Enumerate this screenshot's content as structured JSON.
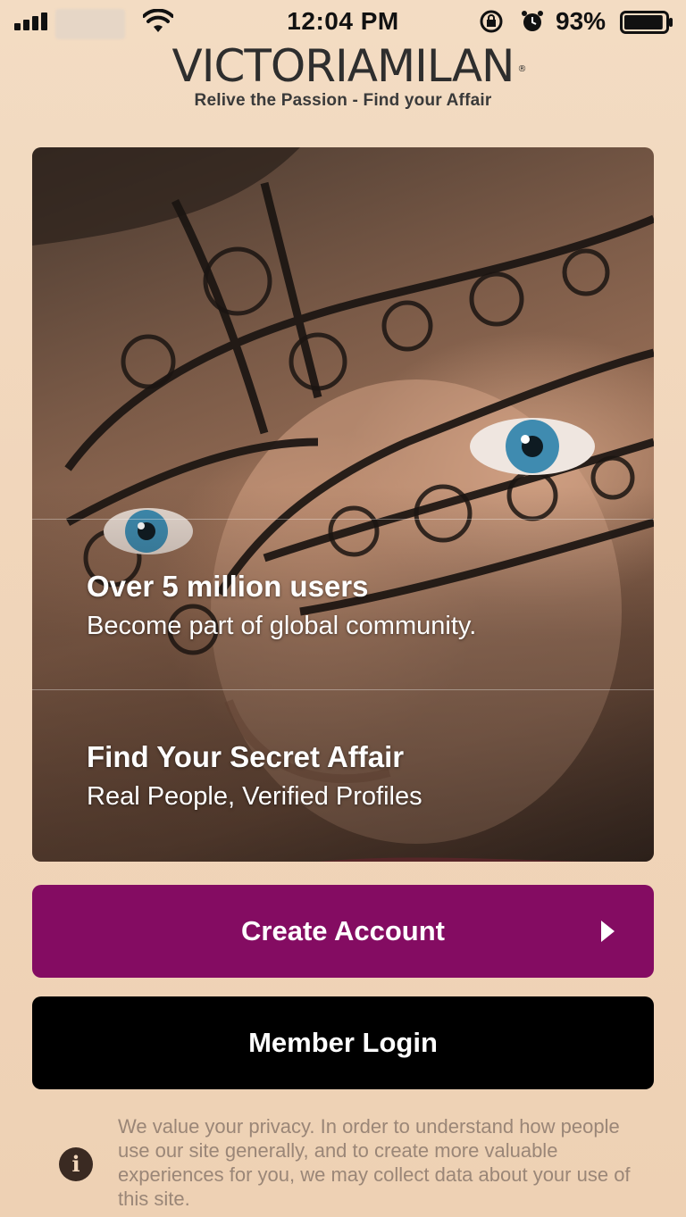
{
  "status_bar": {
    "time": "12:04 PM",
    "battery_percent": "93%",
    "signal_icon": "cellular-signal-icon",
    "wifi_icon": "wifi-icon",
    "orientation_lock_icon": "orientation-lock-icon",
    "alarm_icon": "alarm-clock-icon",
    "battery_icon": "battery-icon",
    "battery_level": 0.93
  },
  "brand": {
    "logo_text": "VICTORIAMILAN",
    "registered_mark": "®",
    "tagline": "Relive the Passion - Find your Affair"
  },
  "hero": {
    "features": [
      {
        "title": "Over 5 million users",
        "subtitle": "Become part of global community."
      },
      {
        "title": "Find Your Secret Affair",
        "subtitle": "Real People, Verified Profiles"
      }
    ]
  },
  "actions": {
    "create_account": "Create Account",
    "member_login": "Member Login",
    "create_color": "#840c62",
    "login_color": "#000000"
  },
  "privacy": {
    "icon": "info-icon",
    "text": "We value your privacy. In order to understand how people use our site generally, and to create more valuable experiences for you, we may collect data about your use of this site."
  }
}
